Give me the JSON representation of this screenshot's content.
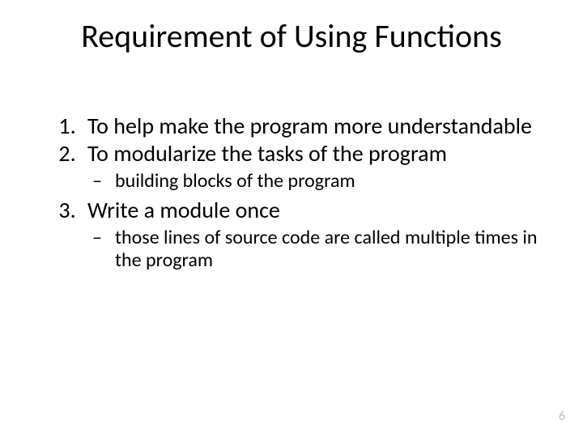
{
  "title": "Requirement of Using Functions",
  "items": [
    {
      "text": "To help make the program more understandable"
    },
    {
      "text": "To modularize the tasks of the program",
      "sub": [
        "building blocks of the program"
      ]
    },
    {
      "text": "Write a module once",
      "sub": [
        "those lines of source code are called multiple times in the program"
      ]
    }
  ],
  "page_number": "6"
}
